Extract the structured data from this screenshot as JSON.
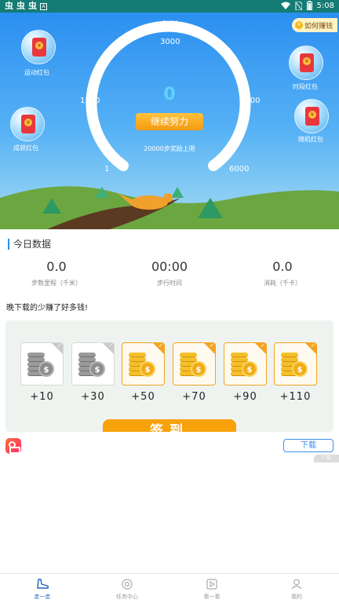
{
  "status_bar": {
    "left_glyphs": [
      "虫",
      "虫",
      "虫"
    ],
    "notification_glyph": "A",
    "time": "5:08"
  },
  "header": {
    "title": "走路",
    "earn_button": "如何赚钱",
    "coin_symbol": "¥"
  },
  "gauge": {
    "steps": "0",
    "ticks": {
      "t1": "1",
      "t1500": "1500",
      "t3000": "3000",
      "t4500": "4500",
      "t6000": "6000"
    },
    "continue_button": "继续努力",
    "limit_text": "20000步奖励上限",
    "progress": 0
  },
  "bubbles": {
    "exercise": "运动红包",
    "achievement": "成就红包",
    "period": "时段红包",
    "random": "随机红包"
  },
  "today": {
    "title": "今日数据",
    "distance": {
      "value": "0.0",
      "label": "步数里程（千米）"
    },
    "time": {
      "value": "00:00",
      "label": "步行时间"
    },
    "calories": {
      "value": "0.0",
      "label": "消耗（千卡）"
    }
  },
  "promo": {
    "text": "晚下载的少赚了好多钱!"
  },
  "signin": {
    "rewards": [
      {
        "label": "+10",
        "style": "gray",
        "coin": "$"
      },
      {
        "label": "+30",
        "style": "gray",
        "coin": "$"
      },
      {
        "label": "+50",
        "style": "gold",
        "coin": "$"
      },
      {
        "label": "+70",
        "style": "gold",
        "coin": "$"
      },
      {
        "label": "+90",
        "style": "gold",
        "coin": "$"
      },
      {
        "label": "+110",
        "style": "gold",
        "coin": "$"
      }
    ],
    "button": "签到"
  },
  "ad": {
    "download_button": "下载",
    "tag": "广告"
  },
  "tabbar": {
    "walk": "走一走",
    "tasks": "任务中心",
    "watch": "看一看",
    "mine": "我的"
  },
  "colors": {
    "status_bar": "#147c74",
    "accent_blue": "#2b8ff0",
    "orange": "#f7a20a",
    "tab_active": "#1f63b8"
  }
}
